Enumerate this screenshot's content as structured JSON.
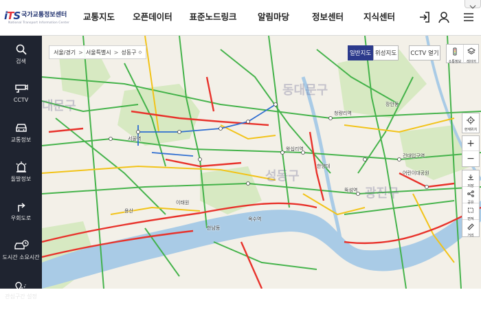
{
  "header": {
    "logo_mark": "iTS",
    "logo_name": "국가교통정보센터",
    "logo_sub": "National Transport Information Center",
    "nav": [
      "교통지도",
      "오픈데이터",
      "표준노드링크",
      "알림마당",
      "정보센터",
      "지식센터"
    ],
    "icons": [
      "login-icon",
      "user-icon",
      "menu-icon",
      "chevron-down-icon"
    ]
  },
  "sidebar": {
    "items": [
      {
        "label": "검색",
        "icon": "search-icon"
      },
      {
        "label": "CCTV",
        "icon": "cctv-icon"
      },
      {
        "label": "교통정보",
        "icon": "car-icon"
      },
      {
        "label": "돌발정보",
        "icon": "siren-icon"
      },
      {
        "label": "우회도로",
        "icon": "detour-icon"
      },
      {
        "label": "도시간 소요시간",
        "icon": "car-clock-icon"
      },
      {
        "label": "관심구간 설정",
        "icon": "route-pin-icon"
      }
    ]
  },
  "map": {
    "breadcrumb": [
      "서울/경기",
      "서울특별시",
      "성동구"
    ],
    "breadcrumb_caret": "⬦",
    "map_types": {
      "general": "일반지도",
      "satellite": "위성지도"
    },
    "cctv_open": "CCTV 열기",
    "tools": [
      {
        "label": "소통정보",
        "icon": "traffic-info-icon"
      },
      {
        "label": "레이어",
        "icon": "layers-icon"
      }
    ],
    "location_btn": {
      "label": "현재위치",
      "icon": "locate-icon"
    },
    "zoom": {
      "in": "+",
      "out": "−"
    },
    "map_tools": [
      {
        "label": "저장",
        "icon": "download-icon"
      },
      {
        "label": "공유",
        "icon": "share-icon"
      },
      {
        "label": "면적",
        "icon": "area-icon"
      },
      {
        "label": "거리",
        "icon": "ruler-icon"
      }
    ],
    "districts": [
      "대문구",
      "동대문구",
      "성동구",
      "광진구"
    ],
    "place_labels": [
      "서울역",
      "청량리역",
      "왕십리역",
      "건대입구역",
      "뚝섬역",
      "옥수역",
      "한양대",
      "용산",
      "이태원",
      "한남동",
      "장안동",
      "어린이대공원"
    ],
    "colors": {
      "green": "#3cb043",
      "yellow": "#f2c318",
      "red": "#e8322b",
      "blue": "#2f6ed1",
      "river": "#aacbe8",
      "park": "#cfe5b4",
      "nav_active": "#2c3a8c",
      "sidebar": "#1f2430"
    }
  }
}
